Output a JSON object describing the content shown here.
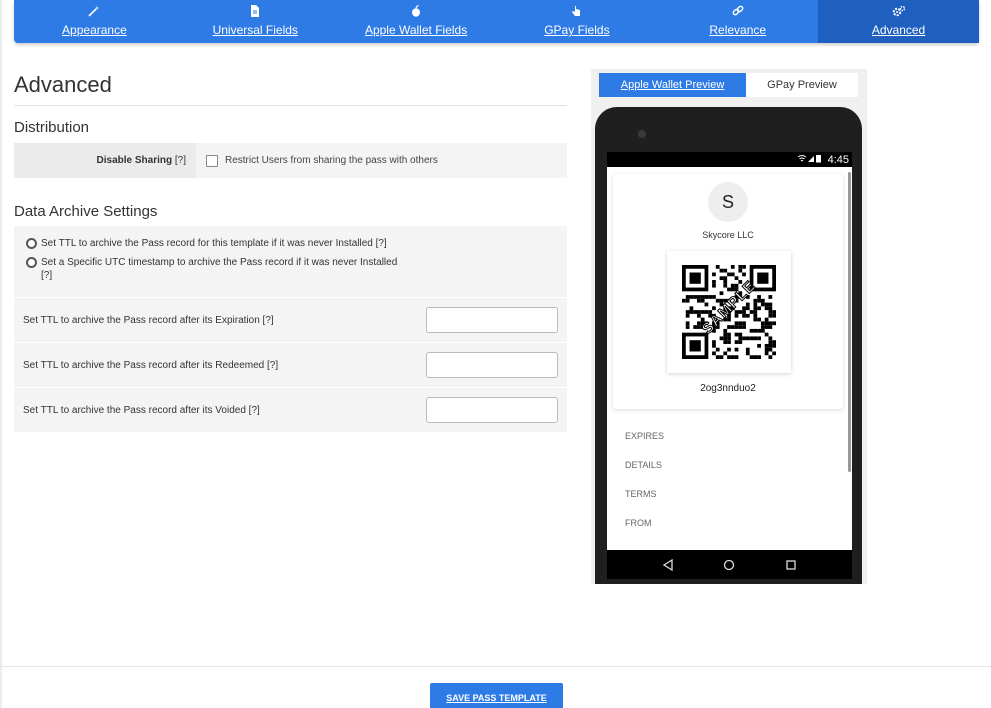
{
  "tabs": [
    {
      "label": "Appearance",
      "icon": "magic-wand-icon"
    },
    {
      "label": "Universal Fields",
      "icon": "document-icon"
    },
    {
      "label": "Apple Wallet Fields",
      "icon": "apple-icon"
    },
    {
      "label": "GPay Fields",
      "icon": "pointer-icon"
    },
    {
      "label": "Relevance",
      "icon": "link-icon"
    },
    {
      "label": "Advanced",
      "icon": "gears-icon"
    }
  ],
  "active_tab": "Advanced",
  "page_title": "Advanced",
  "distribution": {
    "heading": "Distribution",
    "label": "Disable Sharing",
    "help": "[?]",
    "checkbox_label": "Restrict Users from sharing the pass with others",
    "checked": false
  },
  "archive": {
    "heading": "Data Archive Settings",
    "radio1": "Set TTL to archive the Pass record for this template if it was never Installed [?]",
    "radio2": "Set a Specific UTC timestamp to archive the Pass record if it was never Installed [?]",
    "rows": [
      {
        "label": "Set TTL to archive the Pass record after its Expiration [?]",
        "value": ""
      },
      {
        "label": "Set TTL to archive the Pass record after its Redeemed [?]",
        "value": ""
      },
      {
        "label": "Set TTL to archive the Pass record after its Voided [?]",
        "value": ""
      }
    ]
  },
  "preview": {
    "tab_apple": "Apple Wallet Preview",
    "tab_gpay": "GPay Preview",
    "time": "4:45",
    "avatar_letter": "S",
    "org_name": "Skycore LLC",
    "watermark": "SAMPLE",
    "barcode_text": "2og3nnduo2",
    "fields": [
      "EXPIRES",
      "DETAILS",
      "TERMS",
      "FROM"
    ]
  },
  "save_button": "SAVE PASS TEMPLATE",
  "colors": {
    "accent": "#2e7be6",
    "accent_dark": "#1e5fc0"
  }
}
